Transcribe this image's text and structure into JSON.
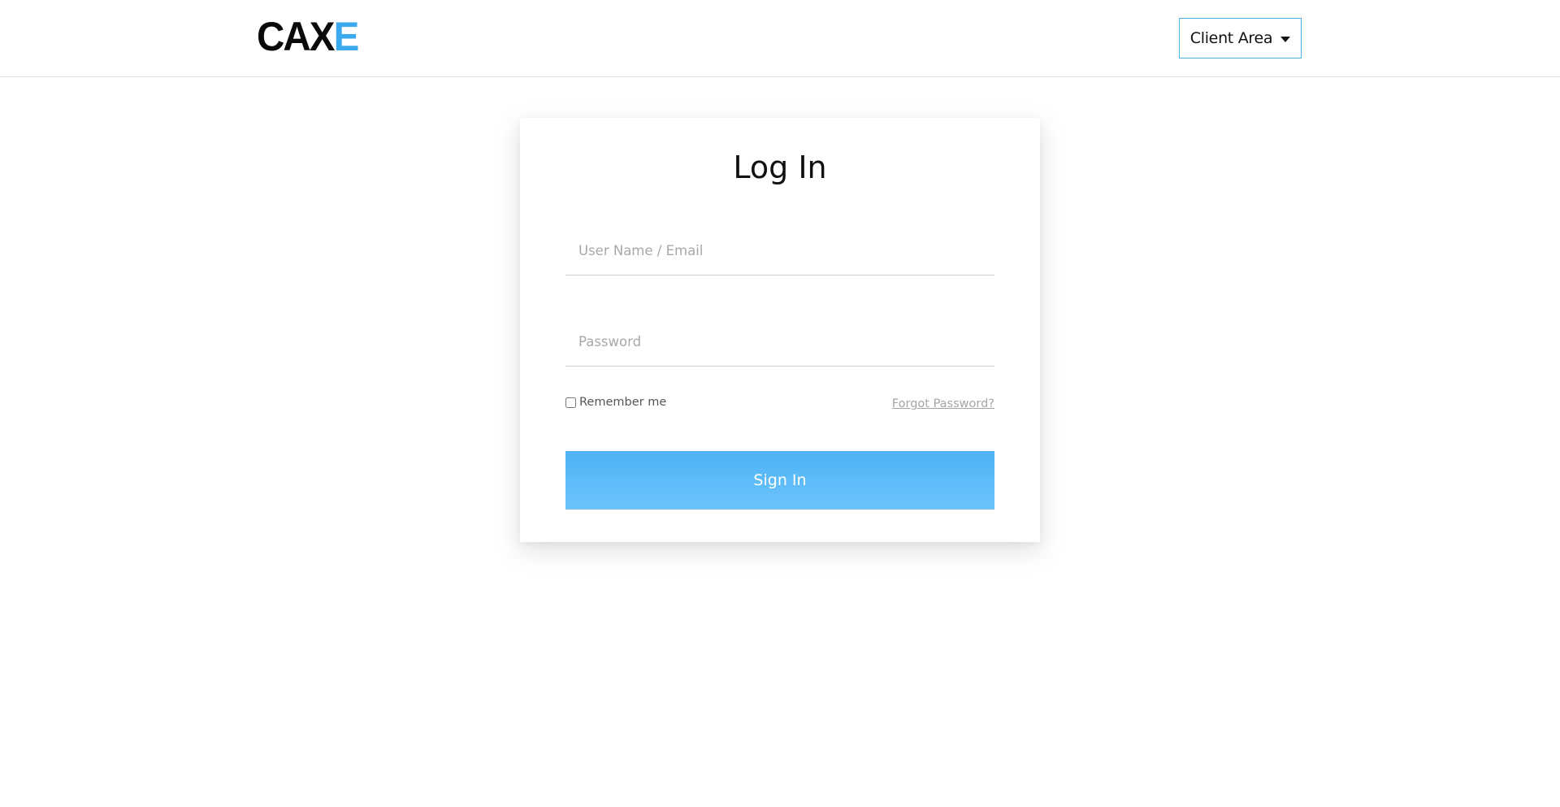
{
  "header": {
    "logo": {
      "part1": "CAX",
      "part2": "E"
    },
    "client_area_label": "Client Area"
  },
  "login": {
    "title": "Log In",
    "username_placeholder": "User Name / Email",
    "password_placeholder": "Password",
    "remember_label": "Remember me",
    "forgot_label": "Forgot Password?",
    "signin_label": "Sign In"
  },
  "colors": {
    "accent": "#3aa9ee",
    "button_top": "#4db3f5",
    "button_bottom": "#6cc3fa",
    "client_border": "#4fb0e0"
  },
  "icons": {
    "dropdown": "caret-down-icon"
  }
}
